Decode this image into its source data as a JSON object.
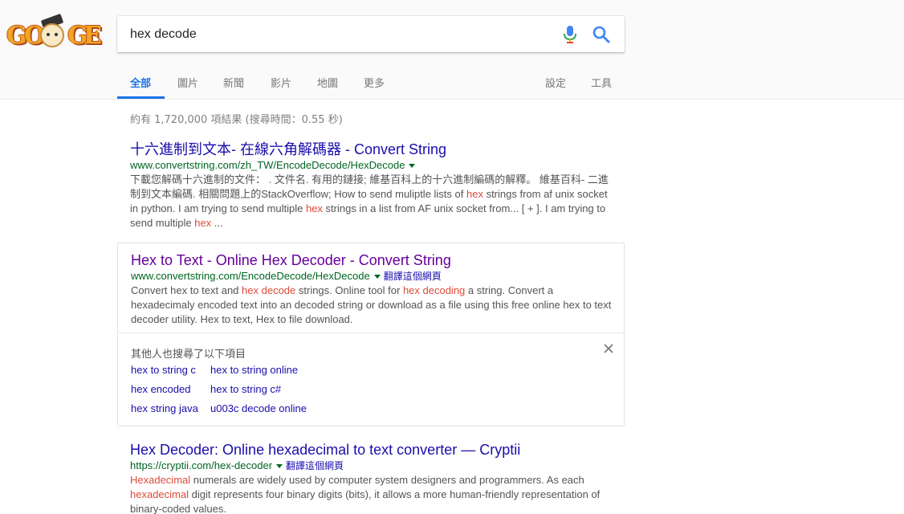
{
  "colors": {
    "link": "#1a0dab",
    "visited_link": "#660099",
    "url_green": "#006621",
    "highlight_red": "#dd4b39",
    "accent_blue": "#1a73e8"
  },
  "logo": {
    "letters": [
      "G",
      "O",
      "G",
      "E"
    ],
    "name": "google-doodle-logo"
  },
  "search": {
    "query": "hex decode",
    "mic_icon": "microphone-icon",
    "search_icon": "magnifier-icon"
  },
  "tabs": {
    "all": "全部",
    "images": "圖片",
    "news": "新聞",
    "videos": "影片",
    "maps": "地圖",
    "more": "更多",
    "settings": "設定",
    "tools": "工具",
    "active": "all"
  },
  "stats": "約有 1,720,000 項結果 (搜尋時間：0.55 秒)",
  "results": [
    {
      "title": "十六進制到文本- 在線六角解碼器 - Convert String",
      "url": "www.convertstring.com/zh_TW/EncodeDecode/HexDecode",
      "translate": "",
      "snippet": [
        {
          "t": "下載您解碼十六進制的文件： . 文件名. 有用的鏈接; 維基百科上的十六進制編碼的解釋。 維基百科- 二進制到文本編碼. 相關問題上的StackOverflow; How to send muliptle lists of ",
          "hl": false
        },
        {
          "t": "hex",
          "hl": true
        },
        {
          "t": " strings from af unix socket in python. I am trying to send multiple ",
          "hl": false
        },
        {
          "t": "hex",
          "hl": true
        },
        {
          "t": " strings in a list from AF unix socket from... [ + ]. I am trying to send multiple ",
          "hl": false
        },
        {
          "t": "hex",
          "hl": true
        },
        {
          "t": " ...",
          "hl": false
        }
      ]
    },
    {
      "title": "Hex to Text - Online Hex Decoder - Convert String",
      "url": "www.convertstring.com/EncodeDecode/HexDecode",
      "translate": "翻譯這個網頁",
      "snippet": [
        {
          "t": "Convert hex to text and ",
          "hl": false
        },
        {
          "t": "hex decode",
          "hl": true
        },
        {
          "t": " strings. Online tool for ",
          "hl": false
        },
        {
          "t": "hex decoding",
          "hl": true
        },
        {
          "t": " a string. Convert a hexadecimaly encoded text into an decoded string or download as a file using this free online hex to text decoder utility. Hex to text, Hex to file download.",
          "hl": false
        }
      ]
    },
    {
      "title": "Hex Decoder: Online hexadecimal to text converter — Cryptii",
      "url": "https://cryptii.com/hex-decoder",
      "translate": "翻譯這個網頁",
      "snippet": [
        {
          "t": "Hexadecimal",
          "hl": true
        },
        {
          "t": " numerals are widely used by computer system designers and programmers. As each ",
          "hl": false
        },
        {
          "t": "hexadecimal",
          "hl": true
        },
        {
          "t": " digit represents four binary digits (bits), it allows a more human-friendly representation of binary-coded values.",
          "hl": false
        }
      ]
    }
  ],
  "related": {
    "title": "其他人也搜尋了以下項目",
    "close_icon": "close-icon",
    "items": [
      "hex to string c",
      "hex to string online",
      "hex encoded",
      "hex to string c#",
      "hex string java",
      "u003c decode online"
    ]
  }
}
